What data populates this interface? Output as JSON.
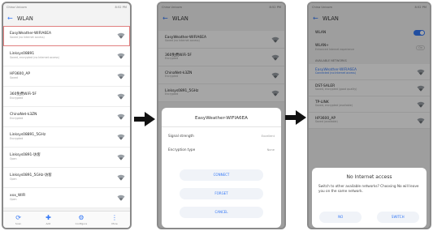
{
  "status_left": [
    "China Unicom",
    "China Unicom",
    "China Unicom"
  ],
  "status_right": [
    "8:52 PM",
    "8:52 PM",
    "8:52 PM"
  ],
  "screen1": {
    "title": "WLAN",
    "networks": [
      {
        "name": "EasyWeather-WIFIA6EA",
        "status": "Saved (no Internet access)",
        "highlight": true
      },
      {
        "name": "Linksys08891",
        "status": "Saved, encrypted (no Internet access)"
      },
      {
        "name": "HP3600_AP",
        "status": "Saved"
      },
      {
        "name": "360免费WiFi-5F",
        "status": "Encrypted"
      },
      {
        "name": "ChinaNet-k3ZN",
        "status": "Encrypted"
      },
      {
        "name": "Linksys08891_5GHz",
        "status": "Encrypted"
      },
      {
        "name": "Linksys0891-访客",
        "status": "Open"
      },
      {
        "name": "Linksys0891_5GHz-访客",
        "status": "Open"
      },
      {
        "name": "xxx_WIFI",
        "status": "Open"
      }
    ],
    "bottom_nav": [
      {
        "icon": "⟳",
        "label": "Scan"
      },
      {
        "icon": "✚",
        "label": "Add"
      },
      {
        "icon": "⚙",
        "label": "Configure"
      },
      {
        "icon": "⋮",
        "label": "More"
      }
    ]
  },
  "screen2": {
    "title": "WLAN",
    "networks": [
      {
        "name": "EasyWeather-WIFIA6EA",
        "status": "Saved (no Internet access)"
      },
      {
        "name": "360免费WiFi-5F",
        "status": "Encrypted"
      },
      {
        "name": "ChinaNet-k3ZN",
        "status": "Encrypted"
      },
      {
        "name": "Linksys0891_5GHz",
        "status": "Encrypted"
      }
    ],
    "dialog": {
      "title": "EasyWeather-WIFIA6EA",
      "signal_label": "Signal strength",
      "signal_value": "Excellent",
      "encryption_label": "Encryption type",
      "encryption_value": "None",
      "connect": "CONNECT",
      "forget": "FORGET",
      "cancel": "CANCEL"
    }
  },
  "screen3": {
    "title": "WLAN",
    "wlan_label": "WLAN",
    "wlan_plus_label": "WLAN+",
    "wlan_plus_sub": "Enhanced Internet experience",
    "wlan_plus_value": "On",
    "section_label": "AVAILABLE NETWORKS",
    "networks": [
      {
        "name": "EasyWeather-WIFIA6EA",
        "status": "Connected (no Internet access)",
        "active": true
      },
      {
        "name": "DST-SALER",
        "status": "Saved, encrypted (good quality)"
      },
      {
        "name": "TP-LINK",
        "status": "Saved, encrypted (available)"
      },
      {
        "name": "HP3600_AP",
        "status": "Saved (available)"
      }
    ],
    "dialog": {
      "title": "No Internet access",
      "message": "Switch to other available networks? Choosing No will leave you on the same network.",
      "no": "NO",
      "switch": "SWITCH"
    }
  },
  "colors": {
    "accent": "#3478f6",
    "arrow": "#111111",
    "highlight_border": "#e08080"
  }
}
